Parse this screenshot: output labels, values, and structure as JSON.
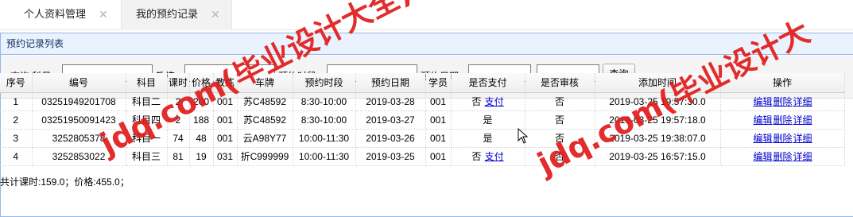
{
  "tabs": [
    {
      "label": "个人资料管理",
      "close": "✕"
    },
    {
      "label": "我的预约记录",
      "close": "✕"
    }
  ],
  "panel": {
    "title": "预约记录列表"
  },
  "search": {
    "label_prefix": "查询 科目：",
    "label_coach": "教练：",
    "label_period": "预约时段：",
    "label_date": "预约日期：",
    "date_sep": "-",
    "button": "查询",
    "subject_value": "",
    "coach_value": "",
    "period_value": "",
    "date_from": "",
    "date_to": ""
  },
  "table": {
    "headers": [
      "序号",
      "编号",
      "科目",
      "课时",
      "价格",
      "教练",
      "车牌",
      "预约时段",
      "预约日期",
      "学员",
      "是否支付",
      "是否审核",
      "添加时间",
      "操作"
    ],
    "rows": [
      {
        "idx": "1",
        "id": "03251949201708",
        "subject": "科目二",
        "hours": "2",
        "price": "200",
        "coach": "001",
        "plate": "苏C48592",
        "period": "8:30-10:00",
        "date": "2019-03-28",
        "student": "001",
        "paid": "否",
        "pay_link": "支付",
        "reviewed": "否",
        "added": "2019-03-25 19:57:30.0"
      },
      {
        "idx": "2",
        "id": "03251950091423",
        "subject": "科目四",
        "hours": "2",
        "price": "188",
        "coach": "001",
        "plate": "苏C48592",
        "period": "8:30-10:00",
        "date": "2019-03-27",
        "student": "001",
        "paid": "是",
        "pay_link": "",
        "reviewed": "否",
        "added": "2019-03-25 19:57:18.0"
      },
      {
        "idx": "3",
        "id": "3252805378",
        "subject": "科目一",
        "hours": "74",
        "price": "48",
        "coach": "001",
        "plate": "云A98Y77",
        "period": "10:00-11:30",
        "date": "2019-03-26",
        "student": "001",
        "paid": "是",
        "pay_link": "",
        "reviewed": "否",
        "added": "2019-03-25 19:38:07.0"
      },
      {
        "idx": "4",
        "id": "3252853022",
        "subject": "科目三",
        "hours": "81",
        "price": "19",
        "coach": "031",
        "plate": "折C999999",
        "period": "10:00-11:30",
        "date": "2019-03-25",
        "student": "001",
        "paid": "否",
        "pay_link": "支付",
        "reviewed": "否",
        "added": "2019-03-25 16:57:15.0"
      }
    ],
    "actions": [
      "编辑",
      "删除",
      "详细"
    ]
  },
  "footer": "共计课时:159.0；价格:455.0；",
  "watermarks": [
    "jdq.com(毕业设计大全)",
    "jdq.com(毕业设计大"
  ],
  "colors": {
    "link": "#0000cc",
    "watermark": "#e11b1b",
    "panel_border": "#95b8e7",
    "panel_header_bg": "#eaf2fd"
  }
}
